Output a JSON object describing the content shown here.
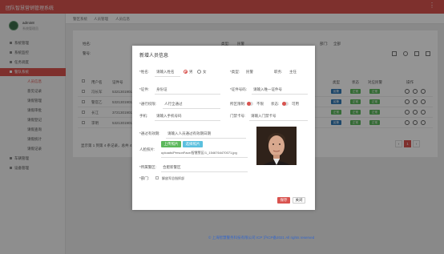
{
  "app": {
    "title": "团队智慧营销管理系统",
    "menu_glyph": "⋮"
  },
  "user": {
    "name": "admin8",
    "role": "系统管理员"
  },
  "sidebar": {
    "items": [
      {
        "label": "系统管理"
      },
      {
        "label": "系统监控"
      },
      {
        "label": "任务调度"
      },
      {
        "label": "警队系统"
      }
    ],
    "sub_items": [
      {
        "label": "人员信息"
      },
      {
        "label": "意见记录"
      },
      {
        "label": "请假管理"
      },
      {
        "label": "请假审批"
      },
      {
        "label": "请假登记"
      },
      {
        "label": "请假查询"
      },
      {
        "label": "请假统计"
      },
      {
        "label": "请假记录"
      }
    ],
    "bottom_items": [
      {
        "label": "车辆管理"
      },
      {
        "label": "设备管理"
      }
    ]
  },
  "breadcrumbs": [
    "警区系统",
    "人员管理",
    "人员信息"
  ],
  "filters": {
    "name_label": "姓名:",
    "type_label": "类型:",
    "type_value": "民警",
    "dept_label": "部门:",
    "dept_value": "全部",
    "number_label": "警号:"
  },
  "table": {
    "headers": [
      "用户名",
      "证件号",
      "类型",
      "状态",
      "对应民警",
      "操作"
    ],
    "rows": [
      {
        "user": "冯长军",
        "id": "5321301901",
        "tags": [
          "民警",
          "正常",
          "正常"
        ]
      },
      {
        "user": "警官乙",
        "id": "5321301901",
        "tags": [
          "民警",
          "正常",
          "正常"
        ]
      },
      {
        "user": "长江",
        "id": "3721301901",
        "tags": [
          "正常",
          "正常",
          "正常"
        ]
      },
      {
        "user": "李明",
        "id": "5321301901",
        "tags": [
          "民警",
          "正常",
          "正常"
        ]
      }
    ],
    "footer": "显示第 1 到第 4 条记录，总共 4 条记录"
  },
  "pager": {
    "prev": "‹",
    "page": "1",
    "next": "›"
  },
  "footer": {
    "text": "© 上海智慧警务科技有限公司 ICP 沪ICP备2021 All rights reserved"
  },
  "modal": {
    "title": "新增人员信息",
    "fields": {
      "name_label": "*姓名:",
      "name_placeholder": "请输入姓名",
      "gender_label": "*性别:",
      "gender_male": "男",
      "gender_female": "女",
      "type_label": "*类型:",
      "type_value": "民警",
      "position_label": "职务:",
      "position_value": "主任",
      "cert_label": "*证件:",
      "cert_value": "身份证",
      "cert_no_label": "*证件号码:",
      "cert_no_placeholder": "请输入唯一证件号",
      "join_label": "*通行权限:",
      "join_value": "人行全通过",
      "zone_label": "所区限制:",
      "zone_value": "不限",
      "status_label": "状态:",
      "status_value": "可用",
      "phone_label": "手机:",
      "phone_placeholder": "请输入手机号码",
      "gate_label": "门禁卡号:",
      "gate_placeholder": "请输入门禁卡号",
      "expire_label": "*通过有效期:",
      "expire_placeholder": "请输入人员通过有效期日期",
      "photo_label": "人脸照片:",
      "upload_btn": "上传照片",
      "select_btn": "选择照片",
      "photo_path": "uploads/PersonFace/智慧警区/1_1546764470071.jpg",
      "zone2_label": "*所属警区:",
      "zone2_value": "合肥新警区",
      "dept_label": "*部门:",
      "dept_value": "解放军总指挥部"
    },
    "save_label": "保存",
    "close_label": "关闭"
  },
  "colors": {
    "accent": "#d9534f",
    "ok": "#5cb85c",
    "info": "#5bc0de",
    "primary": "#337ab7"
  }
}
